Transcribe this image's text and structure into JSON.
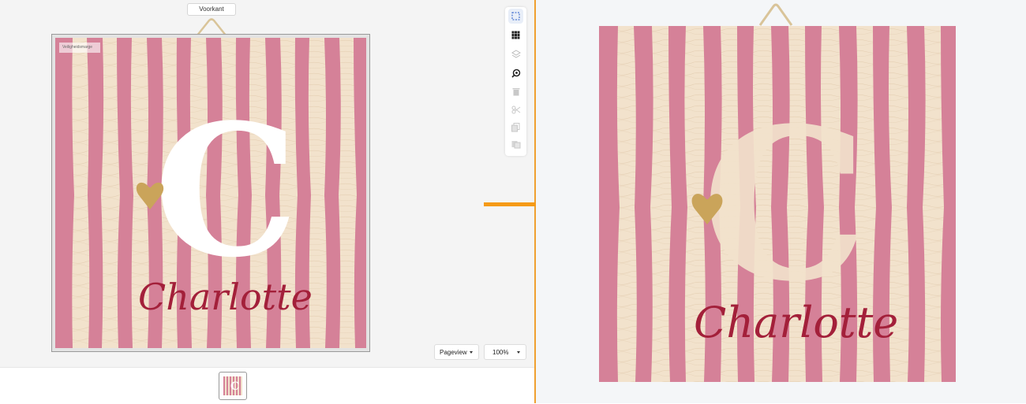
{
  "editor": {
    "side_tab": "Voorkant",
    "safety_margin_label": "Veiligheidsmarge",
    "name_text": "Charlotte",
    "initial_letter": "C",
    "view_dropdown": "Pageview",
    "zoom_dropdown": "100%"
  },
  "toolbar": {
    "tools": [
      {
        "icon": "select-icon",
        "active": true
      },
      {
        "icon": "grid-icon",
        "active": false
      },
      {
        "icon": "layers-icon",
        "active": false
      },
      {
        "icon": "magnify-icon",
        "active": false
      },
      {
        "icon": "trash-icon",
        "active": false
      },
      {
        "icon": "scissors-icon",
        "active": false
      },
      {
        "icon": "copy-icon",
        "active": false
      },
      {
        "icon": "paste-icon",
        "active": false
      }
    ]
  },
  "preview": {
    "name_text": "Charlotte"
  },
  "colors": {
    "stripe_pink": "#d58198",
    "wood": "#f2e2cc",
    "name_red": "#a3203a",
    "heart_gold": "#caa45a",
    "accent_orange": "#f59a17"
  }
}
